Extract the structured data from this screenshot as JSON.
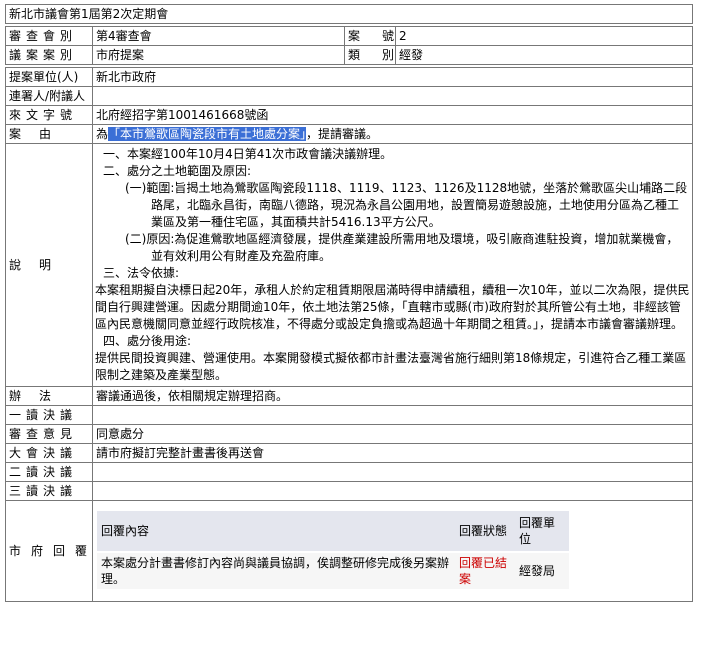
{
  "title": "新北市議會第1屆第2次定期會",
  "committee": {
    "label": "審查會別",
    "value": "第4審查會"
  },
  "case_no": {
    "label": "案號",
    "value": "2"
  },
  "case_type": {
    "label": "議案案別",
    "value": "市府提案"
  },
  "category": {
    "label": "類別",
    "value": "經發"
  },
  "proposer": {
    "label": "提案單位(人)",
    "value": "新北市政府"
  },
  "cosigner": {
    "label": "連署人/附議人",
    "value": ""
  },
  "doc_no": {
    "label": "來文字號",
    "value": "北府經招字第1001461668號函"
  },
  "reason": {
    "label": "案由",
    "prefix": "為",
    "highlight": "「本市鶯歌區陶瓷段市有土地處分案」",
    "suffix": "，提請審議。"
  },
  "explanation": {
    "label": "說明",
    "lines": [
      "一、本案經100年10月4日第41次市政會議決議辦理。",
      "二、處分之土地範圍及原因:",
      "(一)範圍:旨揭土地為鶯歌區陶瓷段1118、1119、1123、1126及1128地號，坐落於鶯歌區尖山埔路二段路尾，北臨永昌街，南臨八德路，現況為永昌公園用地，設置簡易遊憩設施，土地使用分區為乙種工業區及第一種住宅區，其面積共計5416.13平方公尺。",
      "(二)原因:為促進鶯歌地區經濟發展，提供產業建設所需用地及環境，吸引廠商進駐投資，增加就業機會，並有效利用公有財產及充盈府庫。",
      "三、法令依據:",
      "本案租期擬自決標日起20年，承租人於約定租賃期限屆滿時得申請續租，續租一次10年，並以二次為限，提供民間自行興建營運。因處分期間逾10年，依土地法第25條，「直轄市或縣(市)政府對於其所管公有土地，非經該管區內民意機關同意並經行政院核准，不得處分或設定負擔或為超過十年期間之租賃。」，提請本市議會審議辦理。",
      "四、處分後用途:",
      "提供民間投資興建、營運使用。本案開發模式擬依都市計畫法臺灣省施行細則第18條規定，引進符合乙種工業區限制之建築及產業型態。"
    ]
  },
  "method": {
    "label": "辦法",
    "value": "審議通過後，依相關規定辦理招商。"
  },
  "first_reading": {
    "label": "一讀決議",
    "value": ""
  },
  "review_opinion": {
    "label": "審查意見",
    "value": "同意處分"
  },
  "general_assembly": {
    "label": "大會決議",
    "value": "請市府擬訂完整計畫書後再送會"
  },
  "second_reading": {
    "label": "二讀決議",
    "value": ""
  },
  "third_reading": {
    "label": "三讀決議",
    "value": ""
  },
  "gov_reply": {
    "label": "市府回覆",
    "headers": [
      "回覆內容",
      "回覆狀態",
      "回覆單位"
    ],
    "rows": [
      {
        "content": "本案處分計畫書修訂內容尚與議員協調，俟調整研修完成後另案辦理。",
        "status": "回覆已結案",
        "unit": "經發局"
      }
    ]
  },
  "colors": {
    "highlight_bg": "#3b6fd6",
    "status_red": "#cc0000",
    "border": "#777777",
    "reply_header_bg": "#e4e6ee"
  }
}
